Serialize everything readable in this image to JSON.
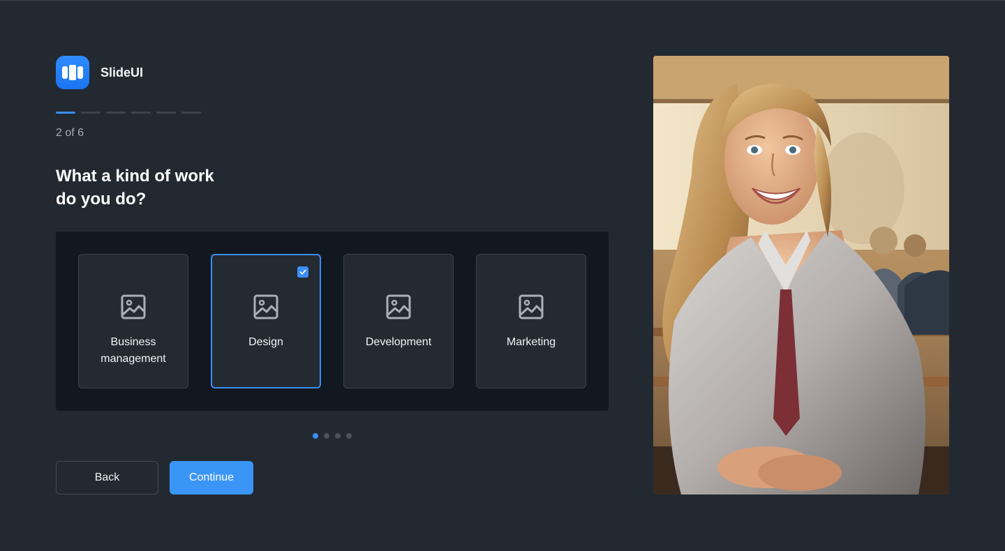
{
  "app": {
    "name": "SlideUI"
  },
  "progress": {
    "current": 2,
    "total": 6,
    "label": "2 of 6"
  },
  "question": {
    "line1": "What a kind of work",
    "line2": "do you do?"
  },
  "options": [
    {
      "label_line1": "Business",
      "label_line2": "management",
      "icon": "image-icon",
      "selected": false
    },
    {
      "label_line1": "Design",
      "label_line2": "",
      "icon": "image-icon",
      "selected": true
    },
    {
      "label_line1": "Development",
      "label_line2": "",
      "icon": "image-icon",
      "selected": false
    },
    {
      "label_line1": "Marketing",
      "label_line2": "",
      "icon": "image-icon",
      "selected": false
    }
  ],
  "pagination": {
    "current": 1,
    "total": 4
  },
  "actions": {
    "back_label": "Back",
    "continue_label": "Continue"
  },
  "colors": {
    "background": "#222931",
    "accent": "#3b8ef6",
    "panel": "#111820",
    "card": "#242a32"
  }
}
